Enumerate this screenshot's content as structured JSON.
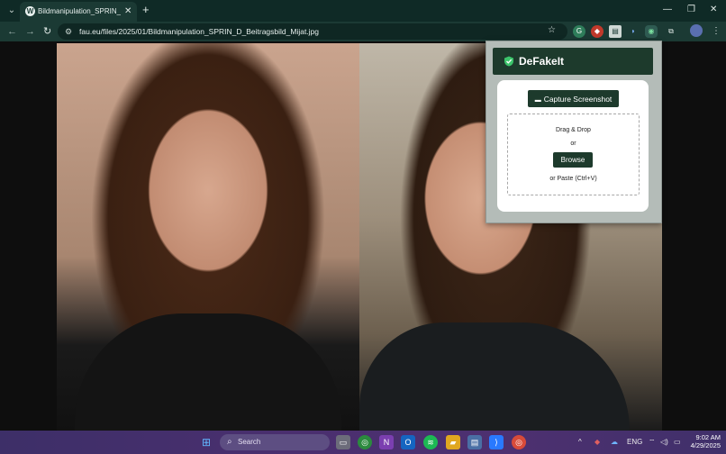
{
  "browser": {
    "tab_title": "Bildmanipulation_SPRIN_D_Beit",
    "url": "fau.eu/files/2025/01/Bildmanipulation_SPRIN_D_Beitragsbild_Mijat.jpg",
    "new_tab_glyph": "+",
    "close_glyph": "✕",
    "nav": {
      "back": "←",
      "forward": "→",
      "reload": "↻"
    },
    "window": {
      "minimize": "—",
      "restore": "❐",
      "close": "✕"
    }
  },
  "extension": {
    "name": "DeFakeIt",
    "capture_label": "Capture Screenshot",
    "drop_label": "Drag & Drop",
    "or_label": "or",
    "browse_label": "Browse",
    "paste_label": "or Paste (Ctrl+V)",
    "brand_color": "#1d3a2c"
  },
  "taskbar": {
    "search_placeholder": "Search",
    "language": "ENG",
    "time": "9:02 AM",
    "date": "4/29/2025"
  }
}
